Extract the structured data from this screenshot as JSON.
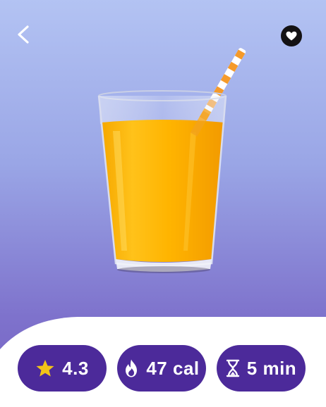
{
  "nav": {
    "back_icon": "chevron-left-icon",
    "favorite_icon": "heart-icon"
  },
  "hero": {
    "image": "orange-juice-glass-with-striped-straw"
  },
  "stats": [
    {
      "icon": "star-icon",
      "value": "4.3",
      "icon_color": "#f2c417"
    },
    {
      "icon": "flame-icon",
      "value": "47 cal",
      "icon_color": "#ffffff"
    },
    {
      "icon": "hourglass-icon",
      "value": "5 min",
      "icon_color": "#ffffff"
    }
  ],
  "colors": {
    "pill_bg": "#4c2a9a",
    "bg_top": "#b3c3f3",
    "bg_bottom": "#7561c2",
    "sheet": "#ffffff"
  }
}
